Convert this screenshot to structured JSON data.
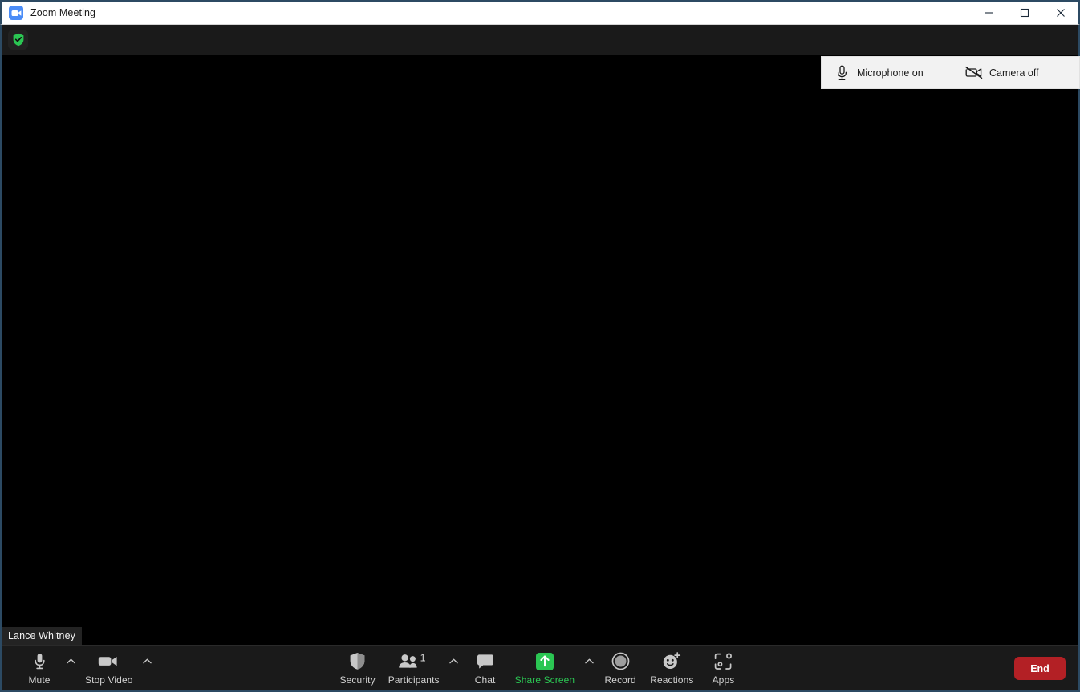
{
  "window": {
    "title": "Zoom Meeting",
    "logo_icon": "zoom-camera-logo-icon",
    "controls": {
      "minimize": "minimize-icon",
      "maximize": "maximize-icon",
      "close": "close-icon"
    }
  },
  "header": {
    "encryption_icon": "green-shield-check-icon"
  },
  "toast": {
    "microphone": {
      "icon": "microphone-icon",
      "label": "Microphone on"
    },
    "camera": {
      "icon": "camera-off-icon",
      "label": "Camera off"
    }
  },
  "stage": {
    "participant_name": "Lance Whitney"
  },
  "toolbar": {
    "mute": {
      "icon": "microphone-icon",
      "label": "Mute",
      "caret": "chevron-up-icon"
    },
    "video": {
      "icon": "camera-icon",
      "label": "Stop Video",
      "caret": "chevron-up-icon"
    },
    "security": {
      "icon": "shield-icon",
      "label": "Security"
    },
    "participants": {
      "icon": "people-icon",
      "label": "Participants",
      "count": "1",
      "caret": "chevron-up-icon"
    },
    "chat": {
      "icon": "speech-bubble-icon",
      "label": "Chat"
    },
    "share_screen": {
      "icon": "up-arrow-icon",
      "label": "Share Screen",
      "caret": "chevron-up-icon"
    },
    "record": {
      "icon": "record-circle-icon",
      "label": "Record"
    },
    "reactions": {
      "icon": "smiley-plus-icon",
      "label": "Reactions"
    },
    "apps": {
      "icon": "apps-bracket-icon",
      "label": "Apps"
    },
    "end": {
      "label": "End"
    }
  },
  "colors": {
    "accent_green": "#2bc653",
    "end_red": "#b32025",
    "zoom_blue": "#4a8cf7",
    "toolbar_bg": "#1a1a1a",
    "stage_bg": "#000000"
  }
}
